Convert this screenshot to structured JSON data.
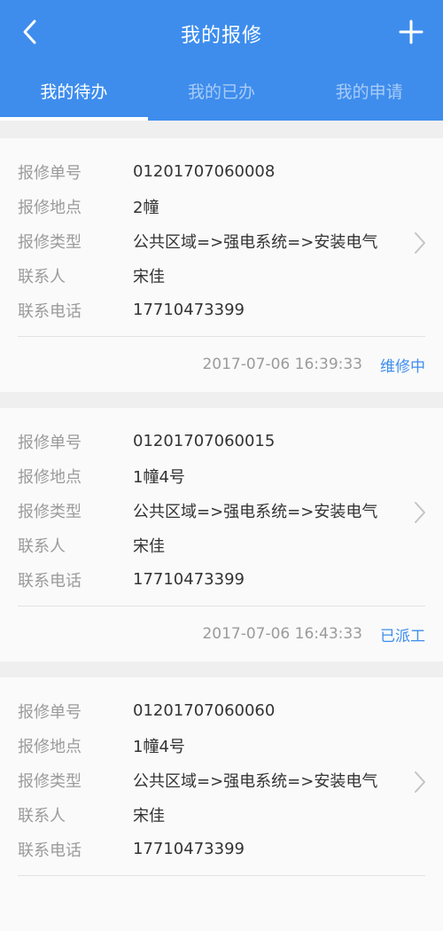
{
  "header": {
    "title": "我的报修",
    "tabs": [
      "我的待办",
      "我的已办",
      "我的申请"
    ]
  },
  "labels": {
    "order_no": "报修单号",
    "location": "报修地点",
    "type": "报修类型",
    "contact": "联系人",
    "phone": "联系电话"
  },
  "items": [
    {
      "order_no": "01201707060008",
      "location": "2幢",
      "type": "公共区域=>强电系统=>安装电气",
      "contact": "宋佳",
      "phone": "17710473399",
      "time": "2017-07-06 16:39:33",
      "status": "维修中"
    },
    {
      "order_no": "01201707060015",
      "location": "1幢4号",
      "type": "公共区域=>强电系统=>安装电气",
      "contact": "宋佳",
      "phone": "17710473399",
      "time": "2017-07-06 16:43:33",
      "status": "已派工"
    },
    {
      "order_no": "01201707060060",
      "location": "1幢4号",
      "type": "公共区域=>强电系统=>安装电气",
      "contact": "宋佳",
      "phone": "17710473399",
      "time": "",
      "status": ""
    }
  ],
  "colors": {
    "primary": "#3e8ded"
  }
}
